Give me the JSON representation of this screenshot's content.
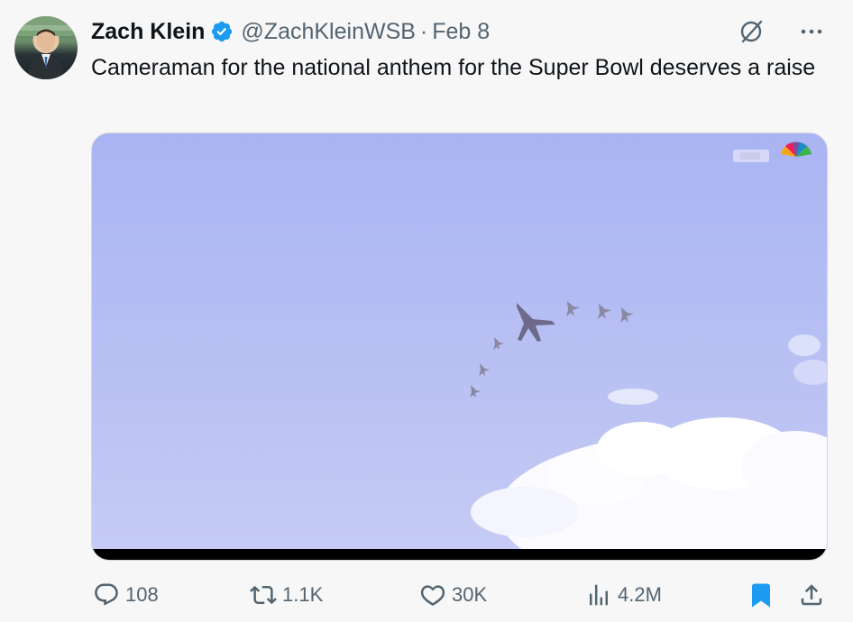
{
  "tweet": {
    "author_name": "Zach Klein",
    "handle": "@ZachKleinWSB",
    "separator": "·",
    "date": "Feb 8",
    "text": "Cameraman for the national anthem for the Super Bowl deserves a raise"
  },
  "stats": {
    "replies": "108",
    "retweets": "1.1K",
    "likes": "30K",
    "views": "4.2M"
  },
  "colors": {
    "verified": "#1d9bf0",
    "bookmark": "#1d9bf0",
    "muted": "#536471",
    "sky": "#b3bcf3"
  },
  "icons": [
    "verified-badge-icon",
    "grok-icon",
    "more-icon",
    "reply-icon",
    "retweet-icon",
    "like-icon",
    "views-icon",
    "bookmark-icon",
    "share-icon"
  ]
}
